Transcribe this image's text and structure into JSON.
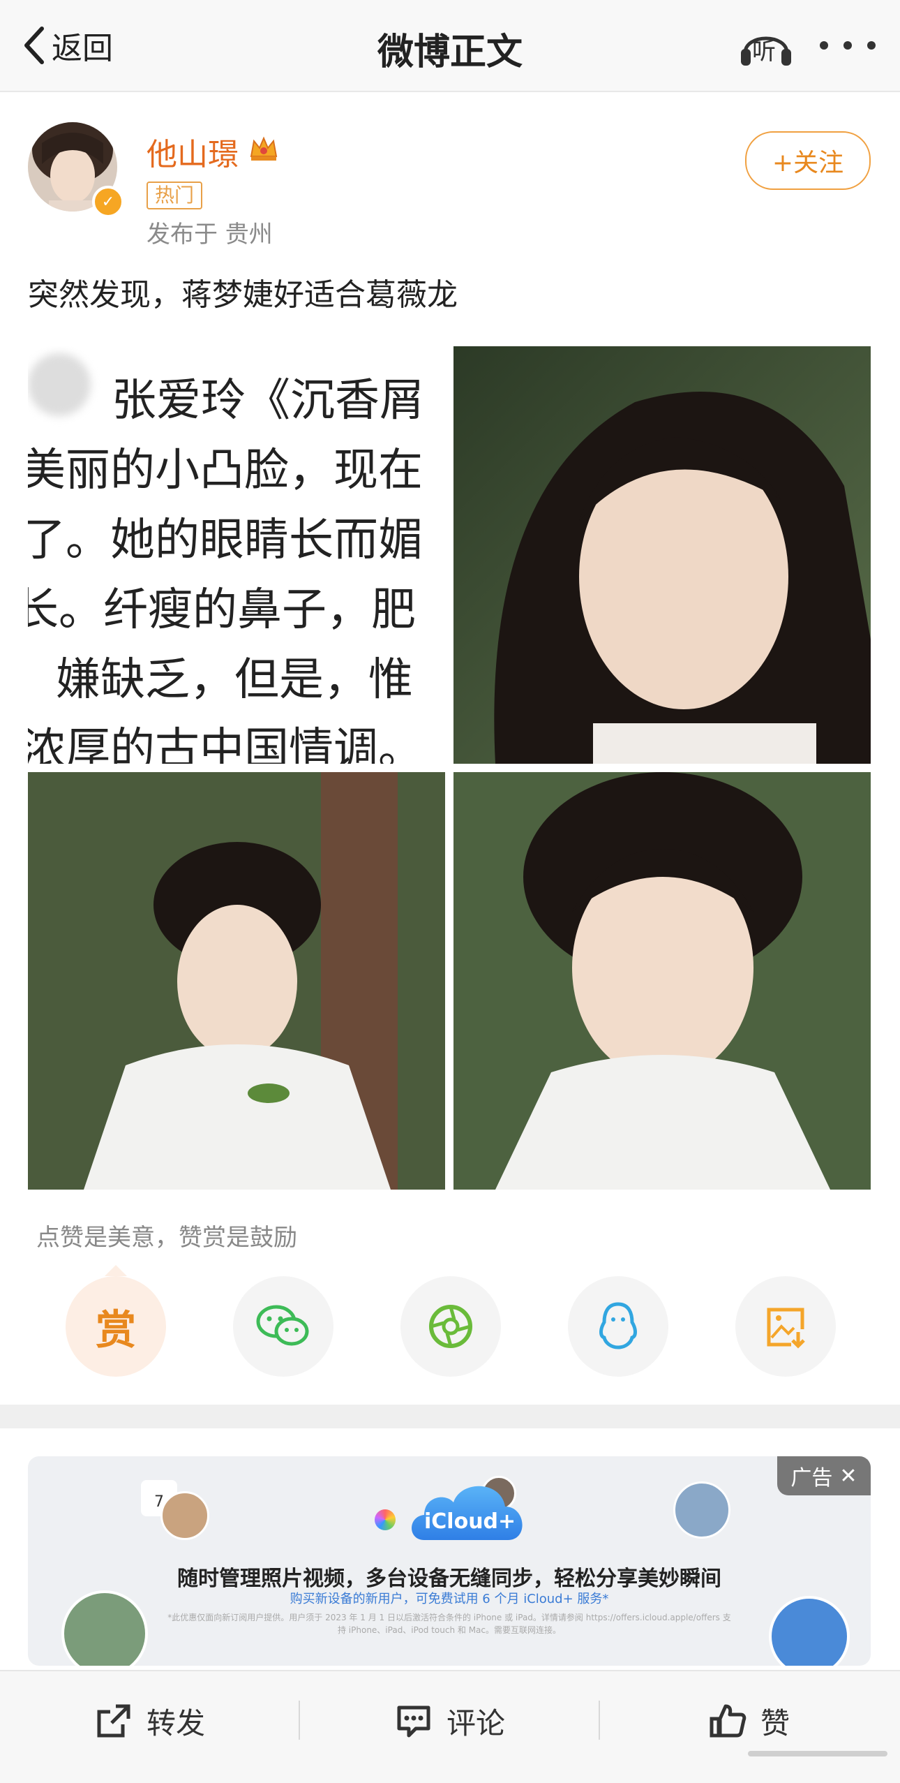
{
  "header": {
    "back_label": "返回",
    "title": "微博正文",
    "listen_label": "听"
  },
  "post": {
    "username": "他山璟",
    "badge_label": "热门",
    "location": "发布于 贵州",
    "follow_label": "+关注",
    "text": "突然发现，蒋梦婕好适合葛薇龙",
    "image1_lines": [
      "张爱玲《沉香屑",
      "美丽的小凸脸，现在",
      "了。她的眼睛长而媚",
      "长。纤瘦的鼻子，肥",
      "嫌缺乏，但是，惟",
      "浓厚的古中国情调。"
    ]
  },
  "reward": {
    "hint": "点赞是美意，赞赏是鼓励",
    "reward_label": "赏"
  },
  "ad": {
    "tag_label": "广告",
    "brand": "iCloud+",
    "calendar_day": "7",
    "headline": "随时管理照片视频，多台设备无缝同步，轻松分享美妙瞬间",
    "subline": "购买新设备的新用户，可免费试用 6 个月 iCloud+ 服务*",
    "fine_print": "*此优惠仅面向新订阅用户提供。用户须于 2023 年 1 月 1 日以后激活符合条件的 iPhone 或 iPad。详情请参阅 https://offers.icloud.apple/offers 支持 iPhone、iPad、iPod touch 和 Mac。需要互联网连接。"
  },
  "bottom_bar": {
    "repost_label": "转发",
    "comment_label": "评论",
    "like_label": "赞"
  },
  "colors": {
    "accent_orange": "#e8881e",
    "username": "#e46a1e",
    "wechat_green": "#3dbb57",
    "moments_green": "#6abb3a",
    "qq_blue": "#31a6e0",
    "save_orange": "#f4a52a"
  }
}
